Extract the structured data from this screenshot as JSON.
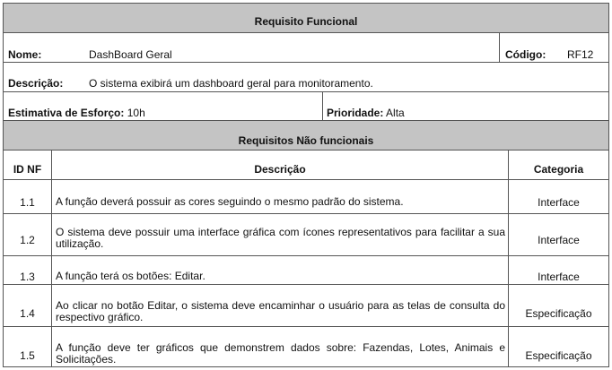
{
  "title": "Requisito Funcional",
  "nome": {
    "label": "Nome:",
    "value": "DashBoard Geral"
  },
  "codigo": {
    "label": "Código:",
    "value": "RF12"
  },
  "descricao": {
    "label": "Descrição:",
    "value": "O sistema exibirá um dashboard geral para monitoramento."
  },
  "estimativa": {
    "label": "Estimativa de Esforço:",
    "value": "10h"
  },
  "prioridade": {
    "label": "Prioridade:",
    "value": "Alta"
  },
  "nf_title": "Requisitos Não funcionais",
  "columns": {
    "id": "ID NF",
    "descricao": "Descrição",
    "categoria": "Categoria"
  },
  "rows": [
    {
      "id": "1.1",
      "descricao": "A função deverá possuir as cores seguindo o mesmo padrão do sistema.",
      "categoria": "Interface"
    },
    {
      "id": "1.2",
      "descricao": "O sistema deve possuir uma interface gráfica com ícones representativos para facilitar a sua utilização.",
      "categoria": "Interface"
    },
    {
      "id": "1.3",
      "descricao": "A função terá os botões: Editar.",
      "categoria": "Interface"
    },
    {
      "id": "1.4",
      "descricao": "Ao clicar no botão Editar, o sistema deve encaminhar o usuário para as telas de consulta do respectivo gráfico.",
      "categoria": "Especificação"
    },
    {
      "id": "1.5",
      "descricao": "A função deve ter gráficos que demonstrem dados sobre: Fazendas, Lotes, Animais e Solicitações.",
      "categoria": "Especificação"
    }
  ]
}
